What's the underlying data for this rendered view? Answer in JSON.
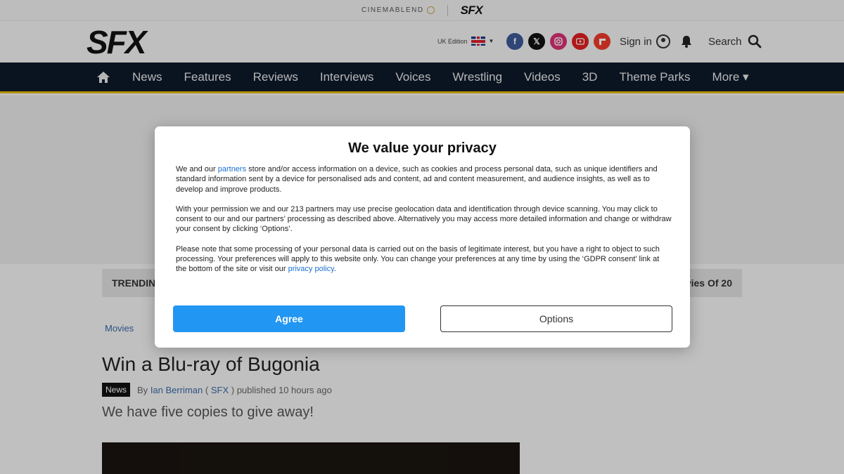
{
  "network": {
    "cinemablend": "CINEMABLEND",
    "sfx": "SFX"
  },
  "header": {
    "logo": "SFX",
    "edition": "UK Edition",
    "signin": "Sign in",
    "search": "Search"
  },
  "nav": {
    "items": [
      "News",
      "Features",
      "Reviews",
      "Interviews",
      "Voices",
      "Wrestling",
      "Videos",
      "3D",
      "Theme Parks",
      "More ▾"
    ]
  },
  "page": {
    "trending_left": "TRENDIN",
    "trending_right": "ovies Of 20",
    "breadcrumb": "Movies",
    "title": "Win a Blu-ray of Bugonia",
    "badge": "News",
    "by": "By",
    "author": "Ian Berriman",
    "paren_open": "(",
    "publication": "SFX",
    "published": ") published 10 hours ago",
    "strap": "We have five copies to give away!"
  },
  "modal": {
    "title": "We value your privacy",
    "p1_pre": "We and our ",
    "p1_link": "partners",
    "p1_post": " store and/or access information on a device, such as cookies and process personal data, such as unique identifiers and standard information sent by a device for personalised ads and content, ad and content measurement, and audience insights, as well as to develop and improve products.",
    "p2": "With your permission we and our 213 partners may use precise geolocation data and identification through device scanning. You may click to consent to our and our partners’ processing as described above. Alternatively you may access more detailed information and change or withdraw your consent by clicking ‘Options’.",
    "p3_pre": "Please note that some processing of your personal data is carried out on the basis of legitimate interest, but you have a right to object to such processing. Your preferences will apply to this website only. You can change your preferences at any time by using the ‘GDPR consent’ link at the bottom of the site or visit our ",
    "p3_link": "privacy policy",
    "p3_post": ".",
    "agree": "Agree",
    "options": "Options"
  },
  "colors": {
    "nav_bg": "#0d1a2b",
    "nav_accent": "#e4b800",
    "agree_btn": "#2196f3",
    "link": "#1a6fd1"
  }
}
